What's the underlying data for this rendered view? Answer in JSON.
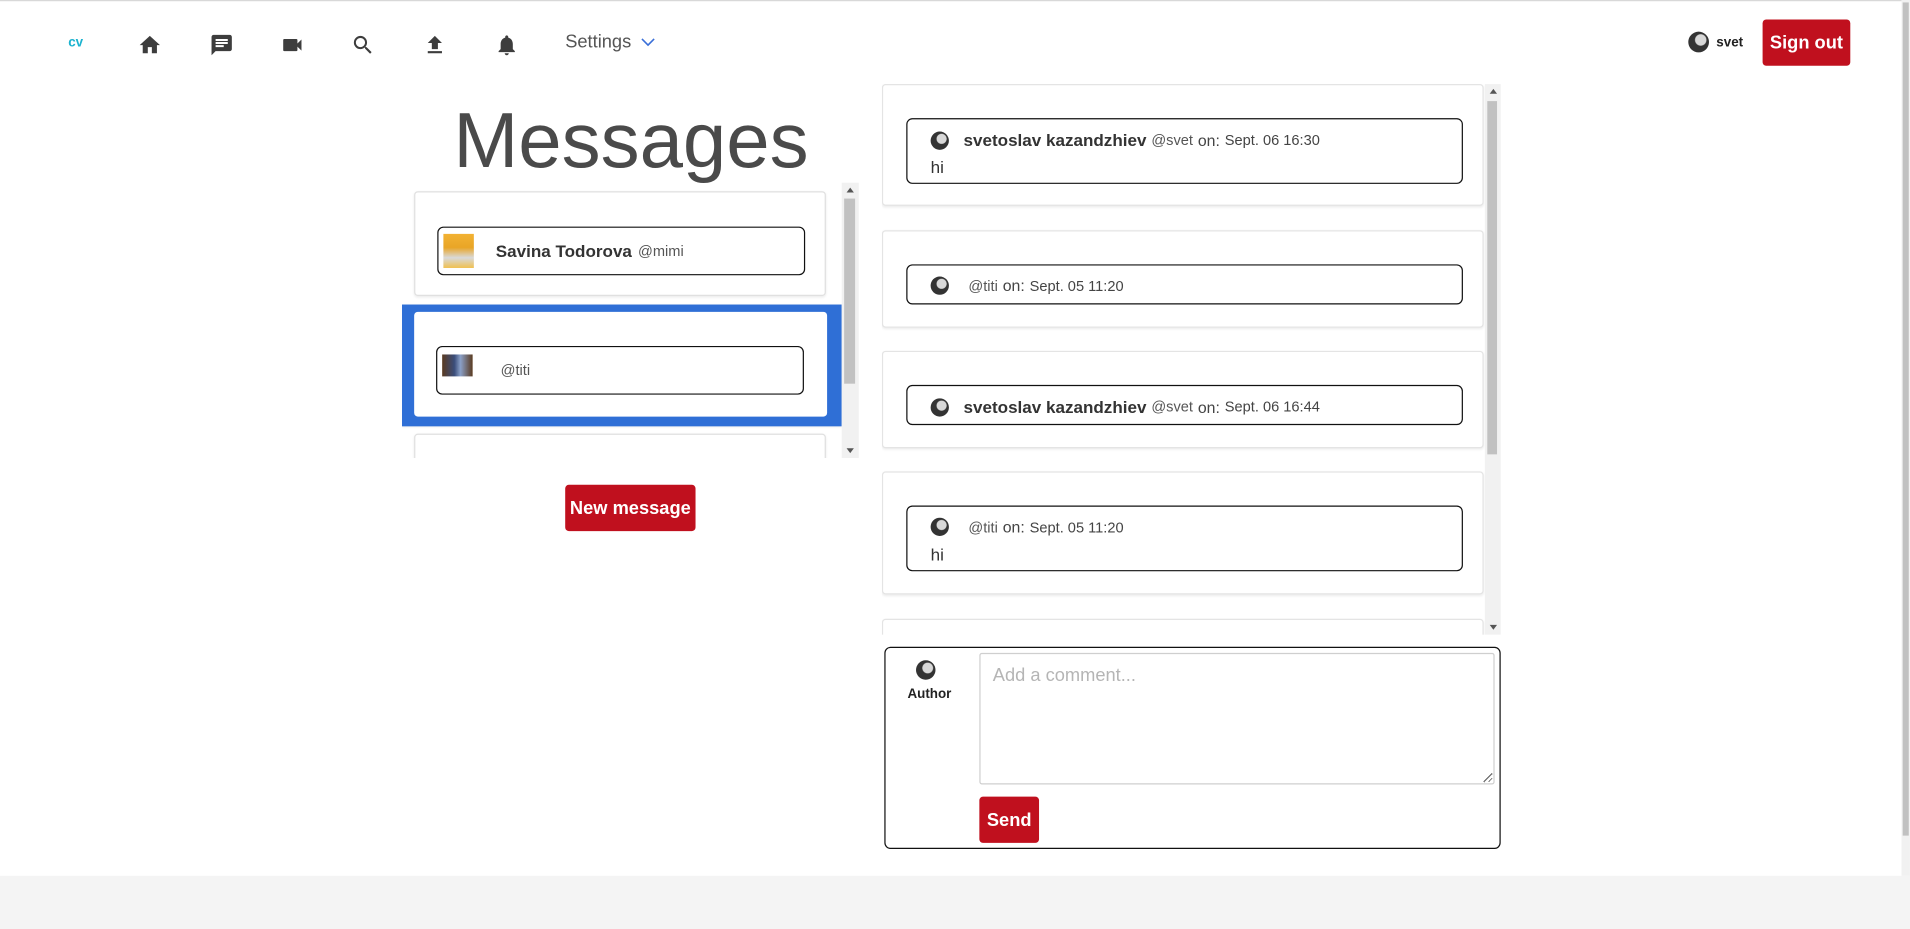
{
  "nav": {
    "logo": "cv",
    "icons": [
      "home-icon",
      "chat-icon",
      "video-icon",
      "search-icon",
      "upload-icon",
      "bell-icon"
    ],
    "settings_label": "Settings",
    "user_name": "svet",
    "sign_out_label": "Sign out"
  },
  "page": {
    "title": "Messages"
  },
  "conversations": [
    {
      "name": "Savina Todorova",
      "handle": "@mimi",
      "active": false
    },
    {
      "name": "",
      "handle": "@titi",
      "active": true
    }
  ],
  "new_message_label": "New message",
  "messages": [
    {
      "author": "svetoslav kazandzhiev",
      "handle": "@svet",
      "on": "on:",
      "time": "Sept. 06 16:30",
      "body": "hi"
    },
    {
      "author": "",
      "handle": "@titi",
      "on": "on:",
      "time": "Sept. 05 11:20",
      "body": ""
    },
    {
      "author": "svetoslav kazandzhiev",
      "handle": "@svet",
      "on": "on:",
      "time": "Sept. 06 16:44",
      "body": ""
    },
    {
      "author": "",
      "handle": "@titi",
      "on": "on:",
      "time": "Sept. 05 11:20",
      "body": "hi"
    }
  ],
  "comment": {
    "author_label": "Author",
    "placeholder": "Add a comment...",
    "send_label": "Send"
  },
  "colors": {
    "accent": "#c0101e",
    "selected": "#2f6fd6",
    "logo": "#1bb3cf"
  }
}
